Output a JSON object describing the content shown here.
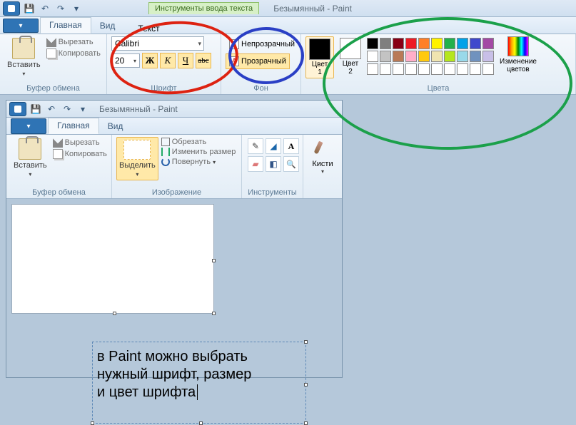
{
  "outer": {
    "toolContextTab": "Инструменты ввода текста",
    "toolContextSub": "Текст",
    "windowTitle": "Безымянный - Paint",
    "tabs": {
      "home": "Главная",
      "view": "Вид"
    },
    "clipboard": {
      "paste": "Вставить",
      "cut": "Вырезать",
      "copy": "Копировать",
      "label": "Буфер обмена"
    },
    "font": {
      "family": "Calibri",
      "size": "20",
      "bold": "Ж",
      "italic": "К",
      "underline": "Ч",
      "strike": "abc",
      "label": "Шрифт"
    },
    "bg": {
      "opaque": "Непрозрачный",
      "transparent": "Прозрачный",
      "label": "Фон"
    },
    "colors": {
      "c1": "Цвет\n1",
      "c2": "Цвет\n2",
      "edit": "Изменение\nцветов",
      "label": "Цвета",
      "palette": [
        "#000000",
        "#7f7f7f",
        "#880015",
        "#ed1c24",
        "#ff7f27",
        "#fff200",
        "#22b14c",
        "#00a2e8",
        "#3f48cc",
        "#a349a4",
        "#ffffff",
        "#c3c3c3",
        "#b97a57",
        "#ffaec9",
        "#ffc90e",
        "#efe4b0",
        "#b5e61d",
        "#99d9ea",
        "#7092be",
        "#c8bfe7",
        "#ffffff",
        "#ffffff",
        "#ffffff",
        "#ffffff",
        "#ffffff",
        "#ffffff",
        "#ffffff",
        "#ffffff",
        "#ffffff",
        "#ffffff"
      ]
    }
  },
  "inner": {
    "windowTitle": "Безымянный - Paint",
    "tabs": {
      "home": "Главная",
      "view": "Вид"
    },
    "clipboard": {
      "paste": "Вставить",
      "cut": "Вырезать",
      "copy": "Копировать",
      "label": "Буфер обмена"
    },
    "image": {
      "select": "Выделить",
      "crop": "Обрезать",
      "resize": "Изменить размер",
      "rotate": "Повернуть",
      "label": "Изображение"
    },
    "tools": {
      "label": "Инструменты",
      "text": "A"
    },
    "brushes": {
      "label": "Кисти"
    },
    "text": {
      "line1": "в Paint можно выбрать",
      "line2": "нужный шрифт, размер",
      "line3": "и цвет шрифта"
    }
  }
}
